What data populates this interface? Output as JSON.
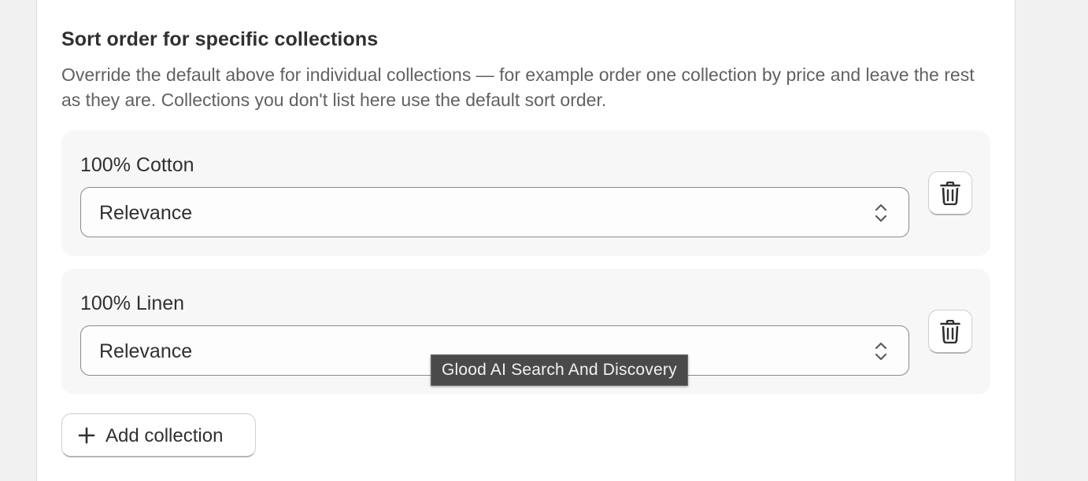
{
  "section": {
    "title": "Sort order for specific collections",
    "description": "Override the default above for individual collections — for example order one collection by price and leave the rest as they are. Collections you don't list here use the default sort order."
  },
  "rows": [
    {
      "label": "100% Cotton",
      "sort_value": "Relevance"
    },
    {
      "label": "100% Linen",
      "sort_value": "Relevance"
    }
  ],
  "add_button": {
    "label": "Add collection",
    "icon": "plus-icon"
  },
  "delete_icon": "trash-icon",
  "select_icon": "select-chevron-icon",
  "tooltip": {
    "text": "Glood AI Search And Discovery"
  },
  "colors": {
    "page_bg": "#f1f1f1",
    "card_bg": "#ffffff",
    "row_bg": "#f7f7f7",
    "text": "#303030",
    "muted_text": "#616161",
    "border": "#8a8a8a",
    "tooltip_bg": "#4a4a4a"
  }
}
